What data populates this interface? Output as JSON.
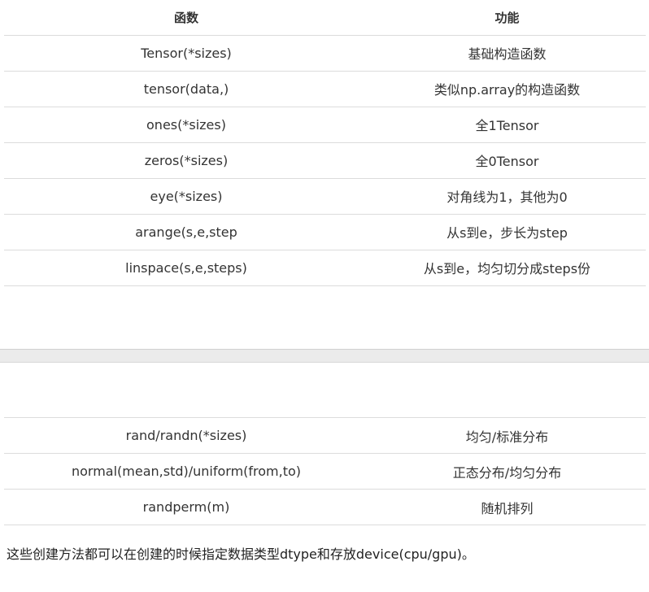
{
  "table_top": {
    "headers": [
      "函数",
      "功能"
    ],
    "rows": [
      [
        "Tensor(*sizes)",
        "基础构造函数"
      ],
      [
        "tensor(data,)",
        "类似np.array的构造函数"
      ],
      [
        "ones(*sizes)",
        "全1Tensor"
      ],
      [
        "zeros(*sizes)",
        "全0Tensor"
      ],
      [
        "eye(*sizes)",
        "对角线为1，其他为0"
      ],
      [
        "arange(s,e,step",
        "从s到e，步长为step"
      ],
      [
        "linspace(s,e,steps)",
        "从s到e，均匀切分成steps份"
      ]
    ]
  },
  "table_bottom": {
    "rows": [
      [
        "rand/randn(*sizes)",
        "均匀/标准分布"
      ],
      [
        "normal(mean,std)/uniform(from,to)",
        "正态分布/均匀分布"
      ],
      [
        "randperm(m)",
        "随机排列"
      ]
    ]
  },
  "note": "这些创建方法都可以在创建的时候指定数据类型dtype和存放device(cpu/gpu)。"
}
